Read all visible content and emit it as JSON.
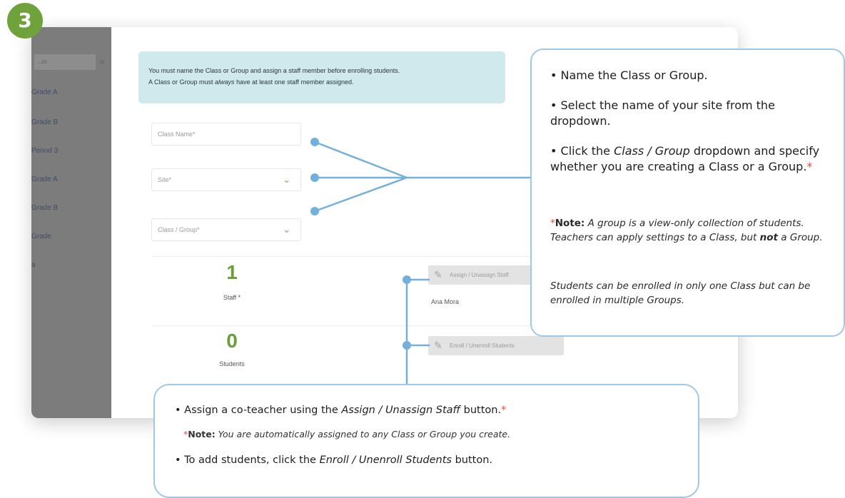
{
  "step_badge": "3",
  "sidebar": {
    "search_placeholder": "...m",
    "menu_glyph": "≡",
    "items": [
      {
        "label": "Grade A"
      },
      {
        "label": "Grade B"
      },
      {
        "label": "Period 3"
      },
      {
        "label": "Grade A"
      },
      {
        "label": "Grade B"
      },
      {
        "label": "Grade"
      },
      {
        "label": "a"
      }
    ]
  },
  "alert": {
    "line1": "You must name the Class or Group and assign a staff member before enrolling students.",
    "line2_prefix": "A Class or Group must ",
    "line2_emphasis": "always",
    "line2_suffix": " have at least one staff member assigned."
  },
  "form": {
    "class_name_placeholder": "Class Name*",
    "site_placeholder": "Site*",
    "class_group_placeholder": "Class / Group*"
  },
  "staff": {
    "count": "1",
    "label": "Staff *",
    "button_label": "Assign / Unassign Staff",
    "member_name": "Ana Mora"
  },
  "students": {
    "count": "0",
    "label": "Students",
    "button_label": "Enroll / Unenroll Students"
  },
  "callout_right": {
    "bullet1": "• Name the Class or Group.",
    "bullet2": "• Select the name of your site from the dropdown.",
    "bullet3_prefix": "• Click the ",
    "bullet3_emphasis": "Class / Group",
    "bullet3_suffix": " dropdown and specify whether you are creating a Class or a Group.",
    "asterisk": "*",
    "note_label": "Note:",
    "note_text_a": " A group is a view-only collection of students. Teachers can apply settings to a Class, but ",
    "note_bold": "not",
    "note_text_b": " a Group.",
    "note2": "Students can be enrolled in only one Class but can be enrolled in multiple Groups."
  },
  "callout_bottom": {
    "bullet1_prefix": "• Assign a co-teacher using the ",
    "bullet1_emphasis": "Assign / Unassign Staff",
    "bullet1_suffix": " button.",
    "asterisk": "*",
    "note_label": "Note:",
    "note_text": " You are automatically assigned to any Class or Group you create.",
    "bullet2_prefix": "• To add students, click the ",
    "bullet2_emphasis": "Enroll / Unenroll Students",
    "bullet2_suffix": " button."
  },
  "colors": {
    "badge_green": "#6fa23b",
    "callout_border": "#9fc8e8",
    "connector": "#74b0dc",
    "alert_bg": "#cfe9ec",
    "asterisk_red": "#e24b3d"
  }
}
